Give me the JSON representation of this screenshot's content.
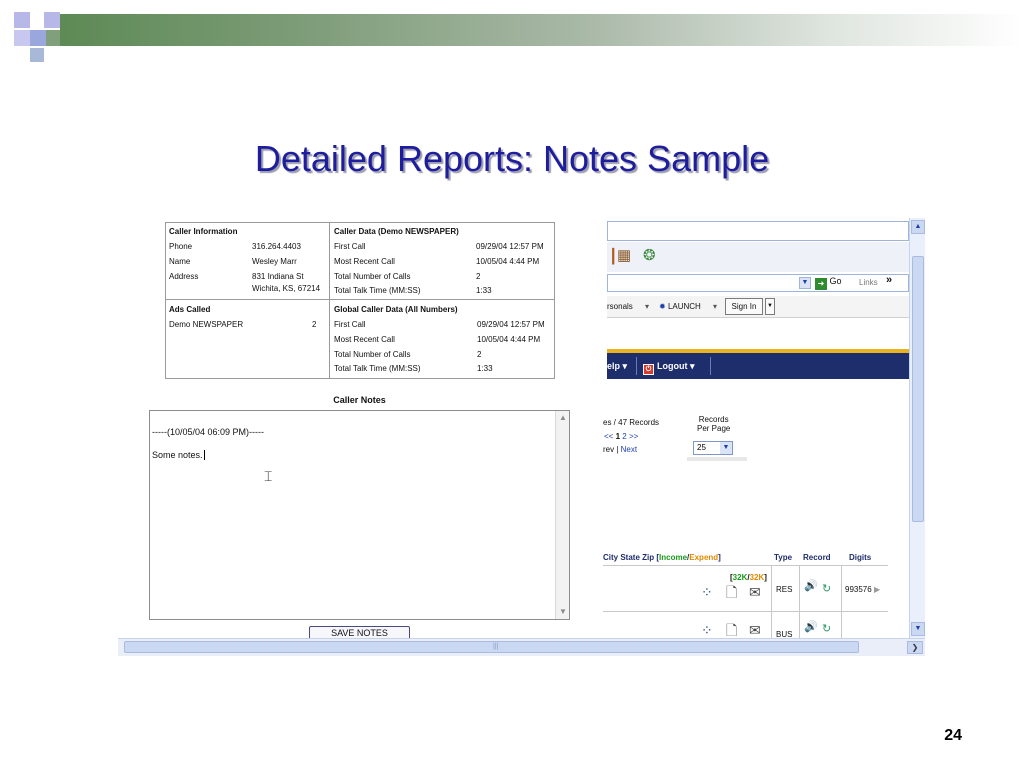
{
  "slide": {
    "title": "Detailed Reports:  Notes Sample",
    "page_number": "24"
  },
  "caller_information": {
    "heading": "Caller Information",
    "rows": [
      {
        "label": "Phone",
        "value": "316.264.4403"
      },
      {
        "label": "Name",
        "value": "Wesley Marr"
      },
      {
        "label": "Address",
        "value": "831 Indiana St",
        "value2": "Wichita, KS, 67214"
      }
    ]
  },
  "caller_data": {
    "heading": "Caller Data (Demo NEWSPAPER)",
    "rows": [
      {
        "label": "First Call",
        "value": "09/29/04 12:57 PM"
      },
      {
        "label": "Most Recent Call",
        "value": "10/05/04 4:44 PM"
      },
      {
        "label": "Total Number of Calls",
        "value": "2"
      },
      {
        "label": "Total Talk Time (MM:SS)",
        "value": "1:33"
      }
    ]
  },
  "ads_called": {
    "heading": "Ads Called",
    "rows": [
      {
        "label": "Demo NEWSPAPER",
        "value": "2"
      }
    ]
  },
  "global_caller_data": {
    "heading": "Global Caller Data (All Numbers)",
    "rows": [
      {
        "label": "First Call",
        "value": "09/29/04 12:57 PM"
      },
      {
        "label": "Most Recent Call",
        "value": "10/05/04 4:44 PM"
      },
      {
        "label": "Total Number of Calls",
        "value": "2"
      },
      {
        "label": "Total Talk Time (MM:SS)",
        "value": "1:33"
      }
    ]
  },
  "caller_notes": {
    "label": "Caller Notes",
    "lines": [
      "-----(10/05/04 06:09 PM)-----",
      "Some notes."
    ],
    "save_label": "SAVE NOTES"
  },
  "browser": {
    "go_label": "Go",
    "links_label": "Links",
    "bookmarks": [
      "rsonals",
      "LAUNCH"
    ],
    "sign_in_label": "Sign In",
    "nav": [
      "elp",
      "Logout"
    ],
    "records_text": "es / 47 Records",
    "pager_prev_next": "<< 1 2 >>",
    "pager_page": "1",
    "prev_label": "rev",
    "next_label": "Next",
    "records_per_page_label": [
      "Records",
      "Per Page"
    ],
    "records_per_page_value": "25",
    "columns": {
      "city_state_zip": "City State Zip [",
      "income": "Income",
      "slash": "/",
      "expend": "Expend",
      "close": "]",
      "type": "Type",
      "record": "Record",
      "digits": "Digits"
    },
    "rows": [
      {
        "badge_a": "32K",
        "badge_b": "32K",
        "type": "RES",
        "digits": "993576"
      },
      {
        "type": "BUS"
      }
    ]
  },
  "colors": {
    "title_blue": "#1e1e9c",
    "nav_navy": "#1e2d6b",
    "accent_yellow": "#e9b320",
    "income_green": "#1a9a1a",
    "expend_orange": "#e08a00"
  }
}
